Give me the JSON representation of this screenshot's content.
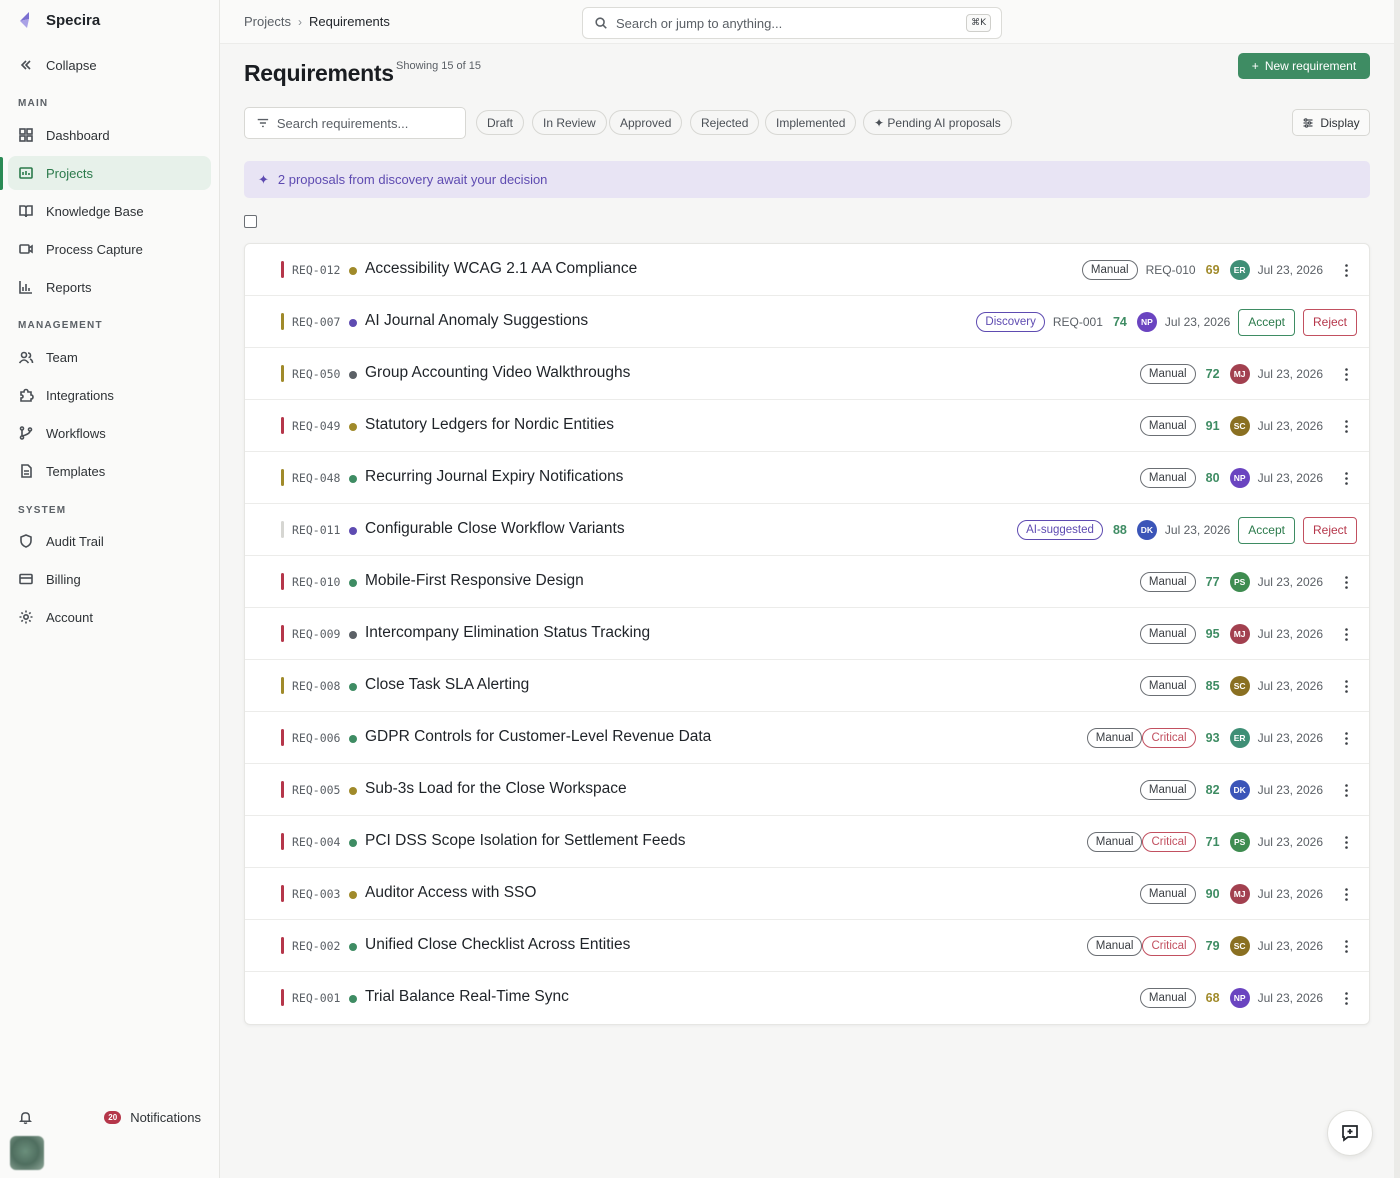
{
  "app": {
    "name": "Specira"
  },
  "sidebar": {
    "collapse_label": "Collapse",
    "sections": [
      {
        "label": "MAIN"
      },
      {
        "label": "MANAGEMENT"
      },
      {
        "label": "SYSTEM"
      }
    ],
    "items": [
      {
        "label": "Dashboard",
        "icon": "grid-icon"
      },
      {
        "label": "Projects",
        "icon": "projects-icon",
        "active": true
      },
      {
        "label": "Knowledge Base",
        "icon": "book-icon"
      },
      {
        "label": "Process Capture",
        "icon": "video-icon"
      },
      {
        "label": "Reports",
        "icon": "bar-chart-icon"
      },
      {
        "label": "Team",
        "icon": "users-icon"
      },
      {
        "label": "Integrations",
        "icon": "puzzle-icon"
      },
      {
        "label": "Workflows",
        "icon": "branch-icon"
      },
      {
        "label": "Templates",
        "icon": "document-icon"
      },
      {
        "label": "Audit Trail",
        "icon": "shield-icon"
      },
      {
        "label": "Billing",
        "icon": "card-icon"
      },
      {
        "label": "Account",
        "icon": "gear-icon"
      }
    ],
    "notifications": {
      "count": "20",
      "label": "Notifications"
    }
  },
  "topbar": {
    "breadcrumb": {
      "parent": "Projects",
      "separator": "›",
      "current": "Requirements"
    },
    "search": {
      "placeholder": "Search or jump to anything...",
      "shortcut": "⌘K"
    }
  },
  "header": {
    "title": "Requirements",
    "showing": "Showing 15 of 15",
    "new_button": "New requirement"
  },
  "filters": {
    "search_placeholder": "Search requirements...",
    "chips": [
      "Draft",
      "In Review",
      "Approved",
      "Rejected",
      "Implemented",
      "✦ Pending AI proposals"
    ],
    "display_label": "Display"
  },
  "banner": {
    "icon": "✦",
    "text": "2 proposals from discovery await your decision"
  },
  "colors": {
    "accent": "#3e8c63",
    "ai_purple": "#5e4bb1",
    "critical": "#c25060"
  },
  "rows": [
    {
      "id": "REQ-012",
      "title": "Accessibility WCAG 2.1 AA Compliance",
      "prio": "#b5364a",
      "dot": "#a08a2a",
      "tags": [
        "Manual"
      ],
      "dep": "REQ-010",
      "score": "69",
      "score_color": "#a08a2a",
      "avatar": "ER",
      "avatar_color": "#3f8f76",
      "date": "Jul 23, 2026",
      "actions": false
    },
    {
      "id": "REQ-007",
      "title": "AI Journal Anomaly Suggestions",
      "prio": "#a08a2a",
      "dot": "#5e4bb1",
      "tags": [
        "Discovery"
      ],
      "dep": "REQ-001",
      "score": "74",
      "score_color": "#3e8c63",
      "avatar": "NP",
      "avatar_color": "#6a44c0",
      "date": "Jul 23, 2026",
      "actions": true,
      "accept": "Accept",
      "reject": "Reject"
    },
    {
      "id": "REQ-050",
      "title": "Group Accounting Video Walkthroughs",
      "prio": "#a08a2a",
      "dot": "#5b6066",
      "tags": [
        "Manual"
      ],
      "dep": "",
      "score": "72",
      "score_color": "#3e8c63",
      "avatar": "MJ",
      "avatar_color": "#a2404f",
      "date": "Jul 23, 2026",
      "actions": false
    },
    {
      "id": "REQ-049",
      "title": "Statutory Ledgers for Nordic Entities",
      "prio": "#b5364a",
      "dot": "#a08a2a",
      "tags": [
        "Manual"
      ],
      "dep": "",
      "score": "91",
      "score_color": "#3e8c63",
      "avatar": "SC",
      "avatar_color": "#8a7022",
      "date": "Jul 23, 2026",
      "actions": false
    },
    {
      "id": "REQ-048",
      "title": "Recurring Journal Expiry Notifications",
      "prio": "#a08a2a",
      "dot": "#3e8c63",
      "tags": [
        "Manual"
      ],
      "dep": "",
      "score": "80",
      "score_color": "#3e8c63",
      "avatar": "NP",
      "avatar_color": "#6a44c0",
      "date": "Jul 23, 2026",
      "actions": false
    },
    {
      "id": "REQ-011",
      "title": "Configurable Close Workflow Variants",
      "prio": "#d6d6d2",
      "dot": "#5e4bb1",
      "tags": [
        "AI-suggested"
      ],
      "dep": "",
      "score": "88",
      "score_color": "#3e8c63",
      "avatar": "DK",
      "avatar_color": "#3b55b8",
      "date": "Jul 23, 2026",
      "actions": true,
      "accept": "Accept",
      "reject": "Reject"
    },
    {
      "id": "REQ-010",
      "title": "Mobile-First Responsive Design",
      "prio": "#b5364a",
      "dot": "#3e8c63",
      "tags": [
        "Manual"
      ],
      "dep": "",
      "score": "77",
      "score_color": "#3e8c63",
      "avatar": "PS",
      "avatar_color": "#3e8c50",
      "date": "Jul 23, 2026",
      "actions": false
    },
    {
      "id": "REQ-009",
      "title": "Intercompany Elimination Status Tracking",
      "prio": "#b5364a",
      "dot": "#5b6066",
      "tags": [
        "Manual"
      ],
      "dep": "",
      "score": "95",
      "score_color": "#3e8c63",
      "avatar": "MJ",
      "avatar_color": "#a2404f",
      "date": "Jul 23, 2026",
      "actions": false
    },
    {
      "id": "REQ-008",
      "title": "Close Task SLA Alerting",
      "prio": "#a08a2a",
      "dot": "#3e8c63",
      "tags": [
        "Manual"
      ],
      "dep": "",
      "score": "85",
      "score_color": "#3e8c63",
      "avatar": "SC",
      "avatar_color": "#8a7022",
      "date": "Jul 23, 2026",
      "actions": false
    },
    {
      "id": "REQ-006",
      "title": "GDPR Controls for Customer-Level Revenue Data",
      "prio": "#b5364a",
      "dot": "#3e8c63",
      "tags": [
        "Manual",
        "Critical"
      ],
      "dep": "",
      "score": "93",
      "score_color": "#3e8c63",
      "avatar": "ER",
      "avatar_color": "#3f8f76",
      "date": "Jul 23, 2026",
      "actions": false
    },
    {
      "id": "REQ-005",
      "title": "Sub-3s Load for the Close Workspace",
      "prio": "#b5364a",
      "dot": "#a08a2a",
      "tags": [
        "Manual"
      ],
      "dep": "",
      "score": "82",
      "score_color": "#3e8c63",
      "avatar": "DK",
      "avatar_color": "#3b55b8",
      "date": "Jul 23, 2026",
      "actions": false
    },
    {
      "id": "REQ-004",
      "title": "PCI DSS Scope Isolation for Settlement Feeds",
      "prio": "#b5364a",
      "dot": "#3e8c63",
      "tags": [
        "Manual",
        "Critical"
      ],
      "dep": "",
      "score": "71",
      "score_color": "#3e8c63",
      "avatar": "PS",
      "avatar_color": "#3e8c50",
      "date": "Jul 23, 2026",
      "actions": false
    },
    {
      "id": "REQ-003",
      "title": "Auditor Access with SSO",
      "prio": "#b5364a",
      "dot": "#a08a2a",
      "tags": [
        "Manual"
      ],
      "dep": "",
      "score": "90",
      "score_color": "#3e8c63",
      "avatar": "MJ",
      "avatar_color": "#a2404f",
      "date": "Jul 23, 2026",
      "actions": false
    },
    {
      "id": "REQ-002",
      "title": "Unified Close Checklist Across Entities",
      "prio": "#b5364a",
      "dot": "#3e8c63",
      "tags": [
        "Manual",
        "Critical"
      ],
      "dep": "",
      "score": "79",
      "score_color": "#3e8c63",
      "avatar": "SC",
      "avatar_color": "#8a7022",
      "date": "Jul 23, 2026",
      "actions": false
    },
    {
      "id": "REQ-001",
      "title": "Trial Balance Real-Time Sync",
      "prio": "#b5364a",
      "dot": "#3e8c63",
      "tags": [
        "Manual"
      ],
      "dep": "",
      "score": "68",
      "score_color": "#a08a2a",
      "avatar": "NP",
      "avatar_color": "#6a44c0",
      "date": "Jul 23, 2026",
      "actions": false
    }
  ]
}
